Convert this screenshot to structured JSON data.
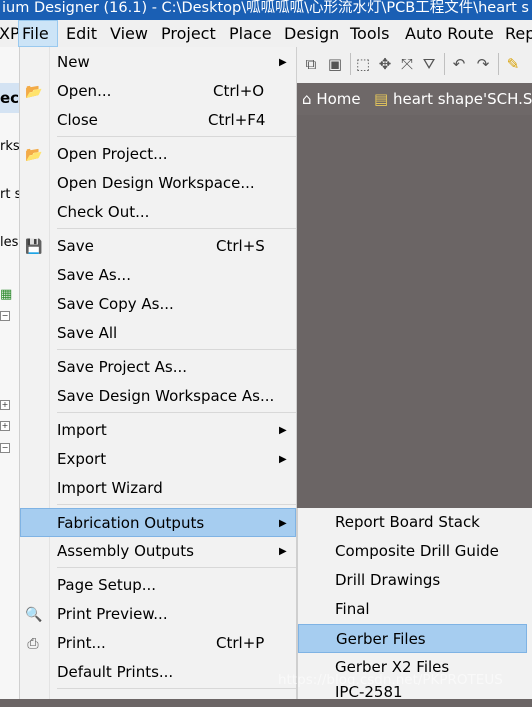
{
  "window": {
    "title": "ium Designer (16.1) - C:\\Desktop\\呱呱呱呱\\心形流水灯\\PCB工程文件\\heart s"
  },
  "menubar": {
    "items": [
      {
        "label": "XP"
      },
      {
        "label": "File"
      },
      {
        "label": "Edit"
      },
      {
        "label": "View"
      },
      {
        "label": "Project"
      },
      {
        "label": "Place"
      },
      {
        "label": "Design"
      },
      {
        "label": "Tools"
      },
      {
        "label": "Auto Route"
      },
      {
        "label": "Rep"
      }
    ]
  },
  "tabs": {
    "home": "Home",
    "doc": "heart shape'SCH.Sc"
  },
  "left_panel": {
    "header": "ect",
    "workspace": "rksp",
    "row1": "rt s",
    "row2": "les"
  },
  "file_menu": {
    "new": "New",
    "open": "Open...",
    "open_sc": "Ctrl+O",
    "close": "Close",
    "close_sc": "Ctrl+F4",
    "open_project": "Open Project...",
    "open_workspace": "Open Design Workspace...",
    "check_out": "Check Out...",
    "save": "Save",
    "save_sc": "Ctrl+S",
    "save_as": "Save As...",
    "save_copy_as": "Save Copy As...",
    "save_all": "Save All",
    "save_project_as": "Save Project As...",
    "save_workspace_as": "Save Design Workspace As...",
    "import": "Import",
    "export": "Export",
    "import_wizard": "Import Wizard",
    "fab_outputs": "Fabrication Outputs",
    "assembly_outputs": "Assembly Outputs",
    "page_setup": "Page Setup...",
    "print_preview": "Print Preview...",
    "print": "Print...",
    "print_sc": "Ctrl+P",
    "default_prints": "Default Prints..."
  },
  "fab_submenu": {
    "report_board_stack": "Report Board Stack",
    "composite_drill_guide": "Composite Drill Guide",
    "drill_drawings": "Drill Drawings",
    "final": "Final",
    "gerber_files": "Gerber Files",
    "gerber_x2": "Gerber X2 Files",
    "ipc2581": "IPC-2581"
  },
  "watermark": "https://blog.csdn.net/PKPROTEUS",
  "colors": {
    "titlebar": "#1a5fb4",
    "highlight": "#a6cdf0",
    "canvas": "#6b6565"
  }
}
